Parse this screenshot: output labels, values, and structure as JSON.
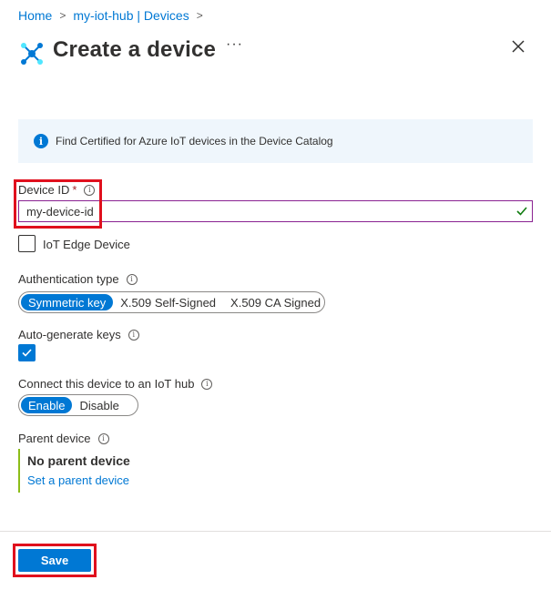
{
  "breadcrumb": {
    "home": "Home",
    "hub": "my-iot-hub | Devices"
  },
  "header": {
    "title": "Create a device",
    "more": "···"
  },
  "info": {
    "text": "Find Certified for Azure IoT devices in the Device Catalog"
  },
  "device_id": {
    "label": "Device ID",
    "required_mark": "*",
    "value": "my-device-id"
  },
  "iot_edge": {
    "label": "IoT Edge Device",
    "checked": false
  },
  "auth": {
    "label": "Authentication type",
    "options": [
      "Symmetric key",
      "X.509 Self-Signed",
      "X.509 CA Signed"
    ],
    "selected": "Symmetric key"
  },
  "auto_keys": {
    "label": "Auto-generate keys",
    "checked": true
  },
  "connect": {
    "label": "Connect this device to an IoT hub",
    "options": [
      "Enable",
      "Disable"
    ],
    "selected": "Enable"
  },
  "parent": {
    "label": "Parent device",
    "value": "No parent device",
    "link": "Set a parent device"
  },
  "footer": {
    "save_label": "Save"
  },
  "colors": {
    "accent": "#0078d4",
    "highlight": "#e0101d",
    "valid": "#107c10"
  }
}
